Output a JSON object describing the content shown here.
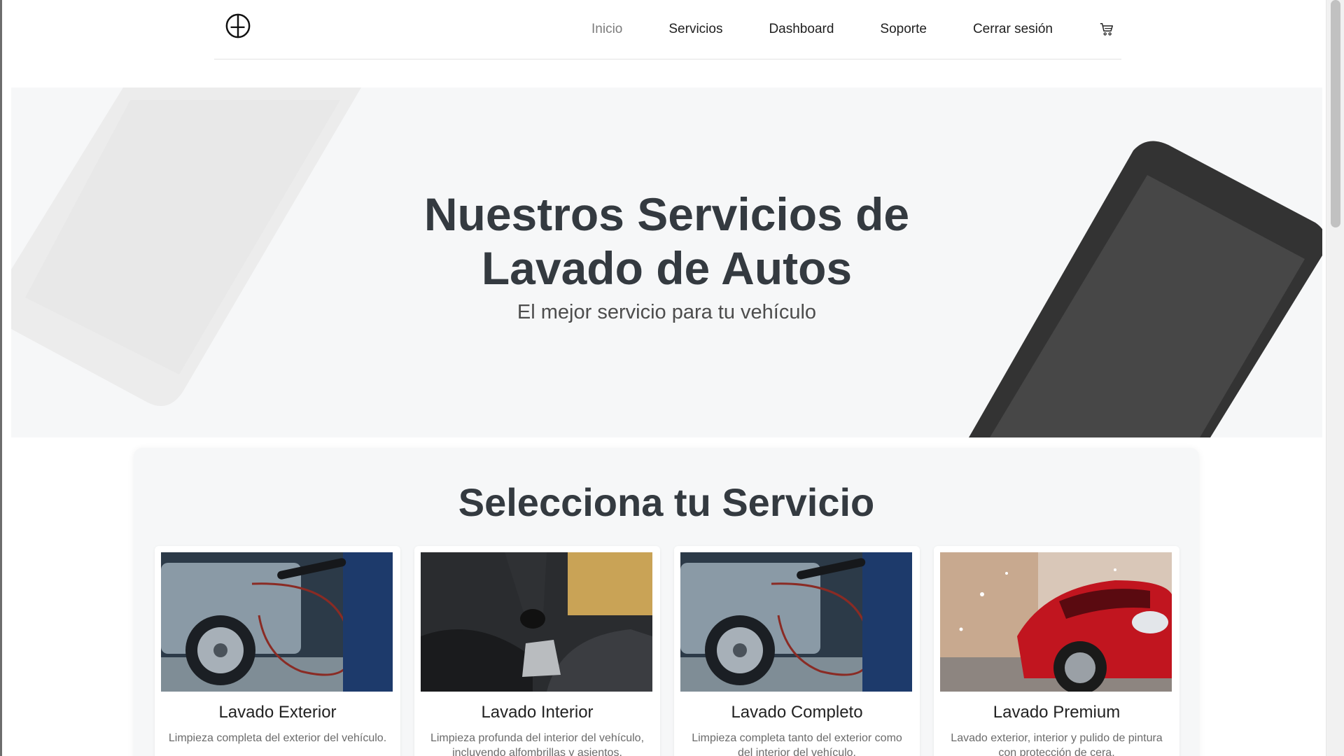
{
  "brand": {
    "logo_icon": "ag-monogram-icon"
  },
  "nav": {
    "items": [
      {
        "label": "Inicio",
        "active": true
      },
      {
        "label": "Servicios",
        "active": false
      },
      {
        "label": "Dashboard",
        "active": false
      },
      {
        "label": "Soporte",
        "active": false
      },
      {
        "label": "Cerrar sesión",
        "active": false
      }
    ],
    "cart_icon": "cart-icon"
  },
  "hero": {
    "title_line1": "Nuestros Servicios de",
    "title_line2": "Lavado de Autos",
    "subtitle": "El mejor servicio para tu vehículo"
  },
  "services": {
    "heading": "Selecciona tu Servicio",
    "cards": [
      {
        "title": "Lavado Exterior",
        "description": "Limpieza completa del exterior del vehículo.",
        "image": "pressure-washing-car-wheel"
      },
      {
        "title": "Lavado Interior",
        "description": "Limpieza profunda del interior del vehículo, incluyendo alfombrillas y asientos.",
        "image": "vacuuming-car-seat"
      },
      {
        "title": "Lavado Completo",
        "description": "Limpieza completa tanto del exterior como del interior del vehículo.",
        "image": "pressure-washing-car-wheel"
      },
      {
        "title": "Lavado Premium",
        "description": "Lavado exterior, interior y pulido de pintura con protección de cera.",
        "image": "red-sports-car-foam"
      }
    ]
  },
  "colors": {
    "heading": "#343a40",
    "nav_active": "#7c7c7c",
    "hero_bg": "#f6f7f8",
    "phone_dark": "#333333"
  }
}
